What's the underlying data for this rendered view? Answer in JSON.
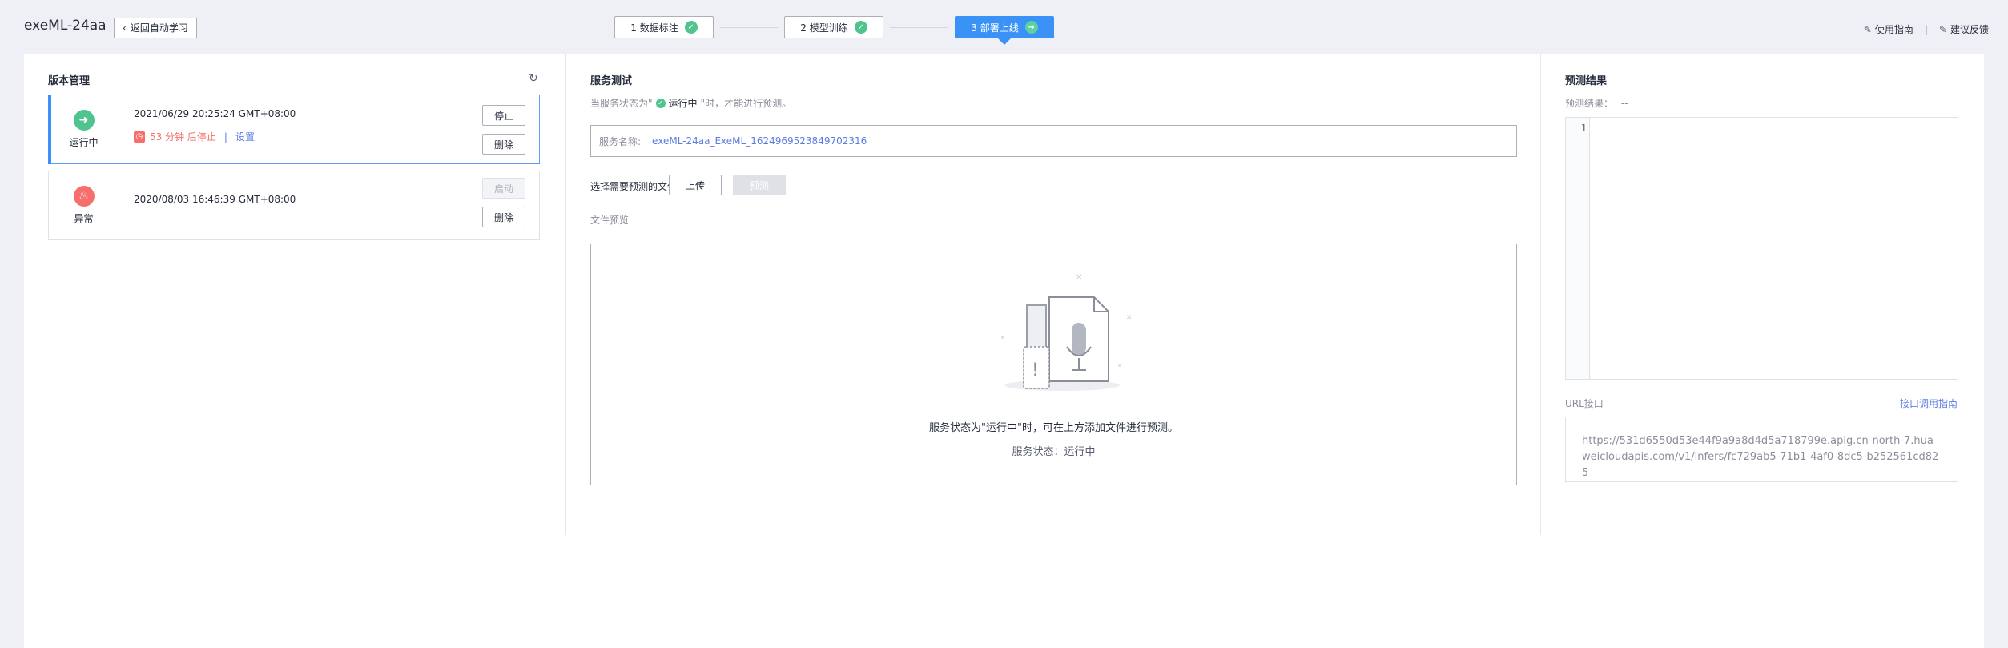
{
  "header": {
    "app_title": "exeML-24aa",
    "back_label": "返回自动学习",
    "steps": [
      {
        "label": "1 数据标注",
        "status": "done"
      },
      {
        "label": "2 模型训练",
        "status": "done"
      },
      {
        "label": "3 部署上线",
        "status": "active"
      }
    ],
    "guide_label": "使用指南",
    "separator": "|",
    "feedback_label": "建议反馈"
  },
  "versions": {
    "title": "版本管理",
    "items": [
      {
        "status_label": "运行中",
        "status_icon": "arrow-right-icon",
        "time": "2021/06/29 20:25:24 GMT+08:00",
        "stop_text": "53 分钟 后停止",
        "pipe": "|",
        "set_link": "设置",
        "primary_btn": "停止",
        "delete_btn": "删除"
      },
      {
        "status_label": "异常",
        "status_icon": "flame-icon",
        "time": "2020/08/03 16:46:39 GMT+08:00",
        "primary_btn": "启动",
        "delete_btn": "删除"
      }
    ]
  },
  "service_test": {
    "title": "服务测试",
    "hint_prefix": "当服务状态为\"",
    "hint_status": "运行中",
    "hint_suffix": "\"时，才能进行预测。",
    "service_name_label": "服务名称:",
    "service_name_value": "exeML-24aa_ExeML_1624969523849702316",
    "select_file_label": "选择需要预测的文件",
    "upload_btn": "上传",
    "predict_btn": "预测",
    "preview_label": "文件预览",
    "empty_main": "服务状态为\"运行中\"时，可在上方添加文件进行预测。",
    "empty_sub": "服务状态：运行中"
  },
  "prediction": {
    "title": "预测结果",
    "result_label": "预测结果：",
    "result_value": "--",
    "line_number": "1",
    "url_label": "URL接口",
    "url_guide": "接口调用指南",
    "url_value": "https://531d6550d53e44f9a9a8d4d5a718799e.apig.cn-north-7.huaweicloudapis.com/v1/infers/fc729ab5-71b1-4af0-8dc5-b252561cd825"
  },
  "colors": {
    "accent": "#3a92f7",
    "success": "#50c38e",
    "danger": "#f66f6a",
    "link": "#5e7ce0"
  }
}
